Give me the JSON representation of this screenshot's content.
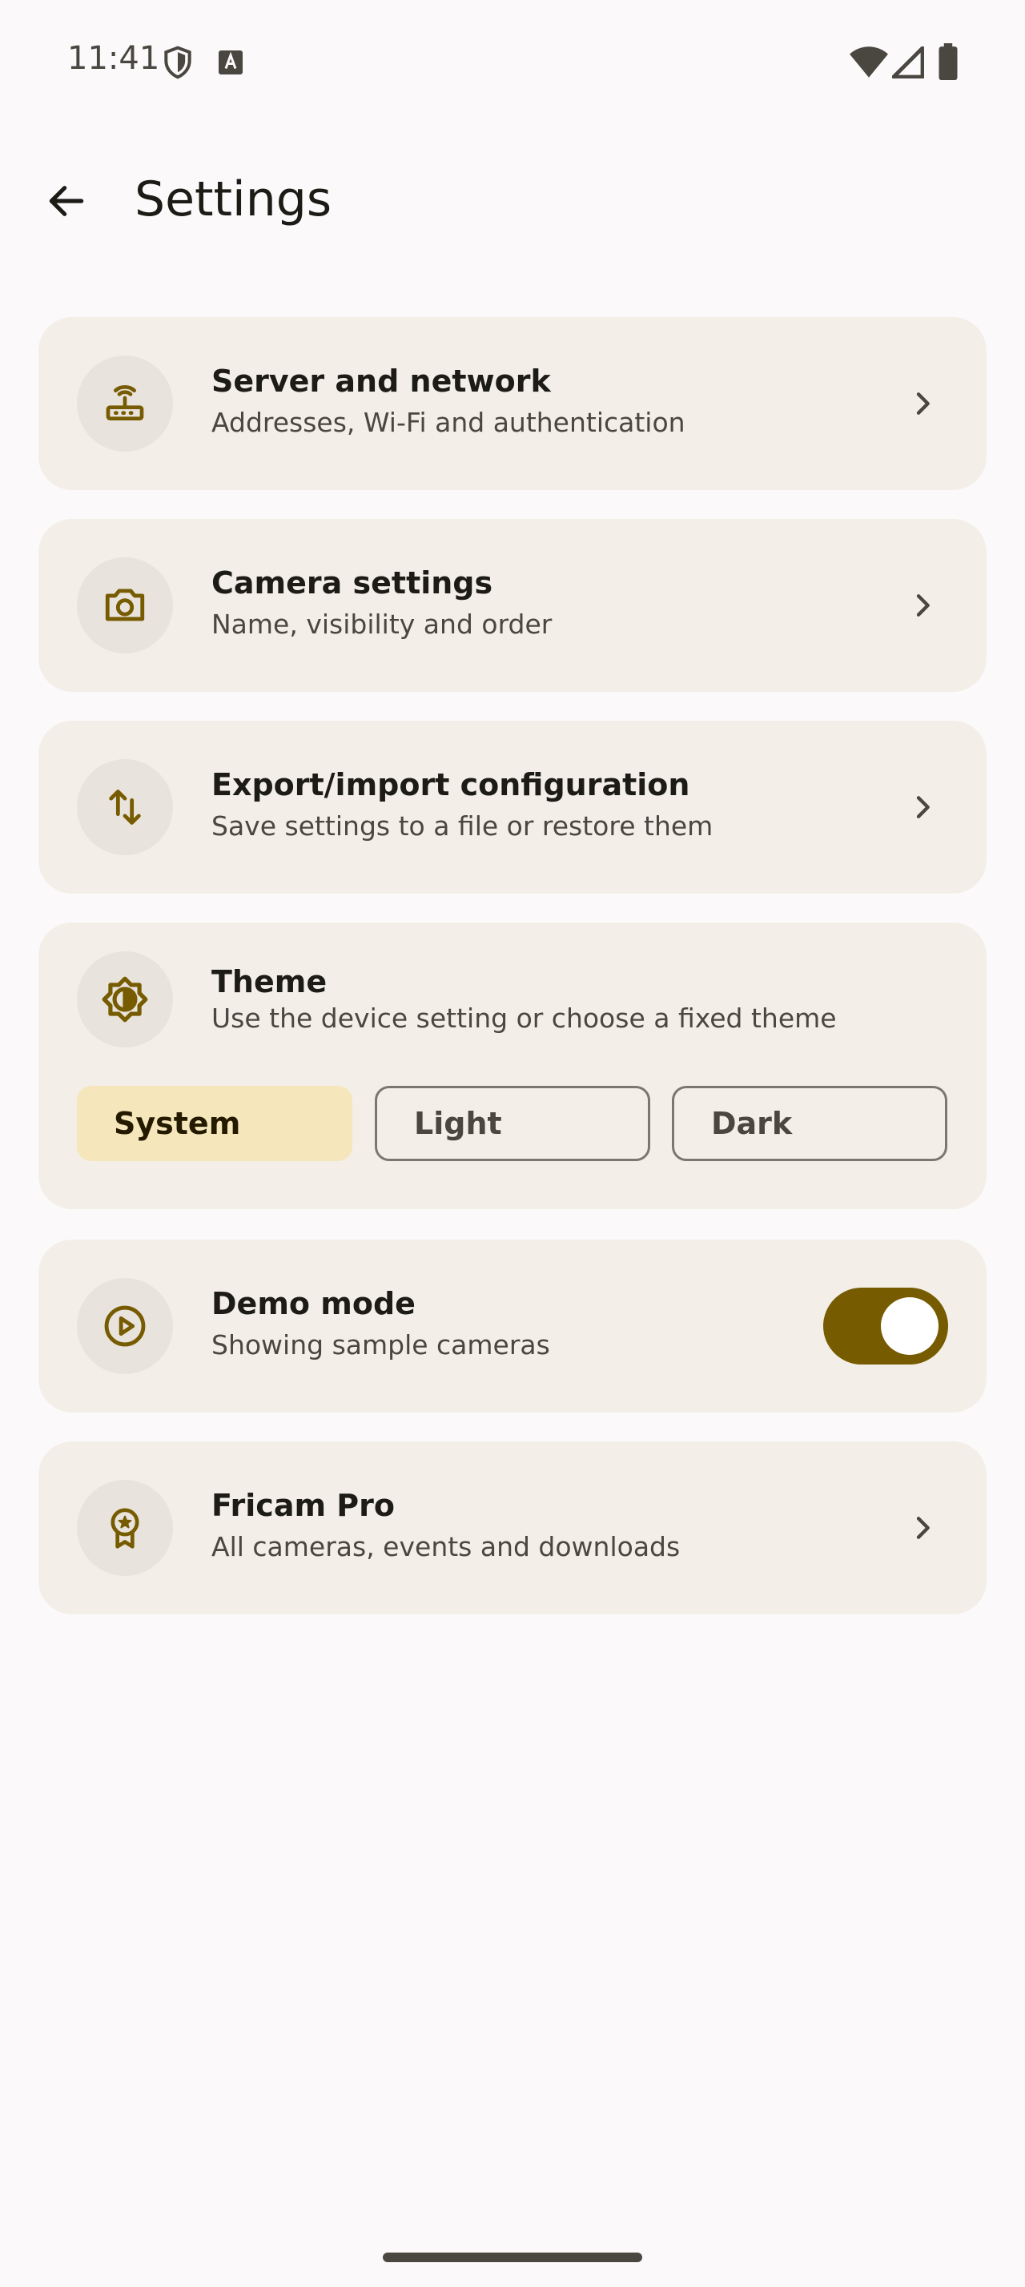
{
  "status_bar": {
    "time": "11:41",
    "icons": [
      "shield-icon",
      "font-icon",
      "wifi-icon",
      "cell-signal-icon",
      "battery-icon"
    ]
  },
  "header": {
    "title": "Settings",
    "back_icon": "arrow-back-icon"
  },
  "settings": {
    "server": {
      "title": "Server and network",
      "subtitle": "Addresses, Wi-Fi and authentication",
      "icon": "router-icon"
    },
    "camera": {
      "title": "Camera settings",
      "subtitle": "Name, visibility and order",
      "icon": "camera-icon"
    },
    "export": {
      "title": "Export/import configuration",
      "subtitle": "Save settings to a file or restore them",
      "icon": "swap-vert-icon"
    },
    "theme": {
      "title": "Theme",
      "subtitle": "Use the device setting or choose a fixed theme",
      "icon": "brightness-icon",
      "options": [
        "System",
        "Light",
        "Dark"
      ],
      "selected": "System"
    },
    "demo": {
      "title": "Demo mode",
      "subtitle": "Showing sample cameras",
      "icon": "play-circle-icon",
      "enabled": true
    },
    "pro": {
      "title": "Fricam Pro",
      "subtitle": "All cameras, events and downloads",
      "icon": "award-icon"
    }
  },
  "colors": {
    "accent": "#765b00",
    "card_background": "#f3efe8",
    "selected_chip": "#f5e6bc",
    "page_background": "#fcf9fb"
  }
}
